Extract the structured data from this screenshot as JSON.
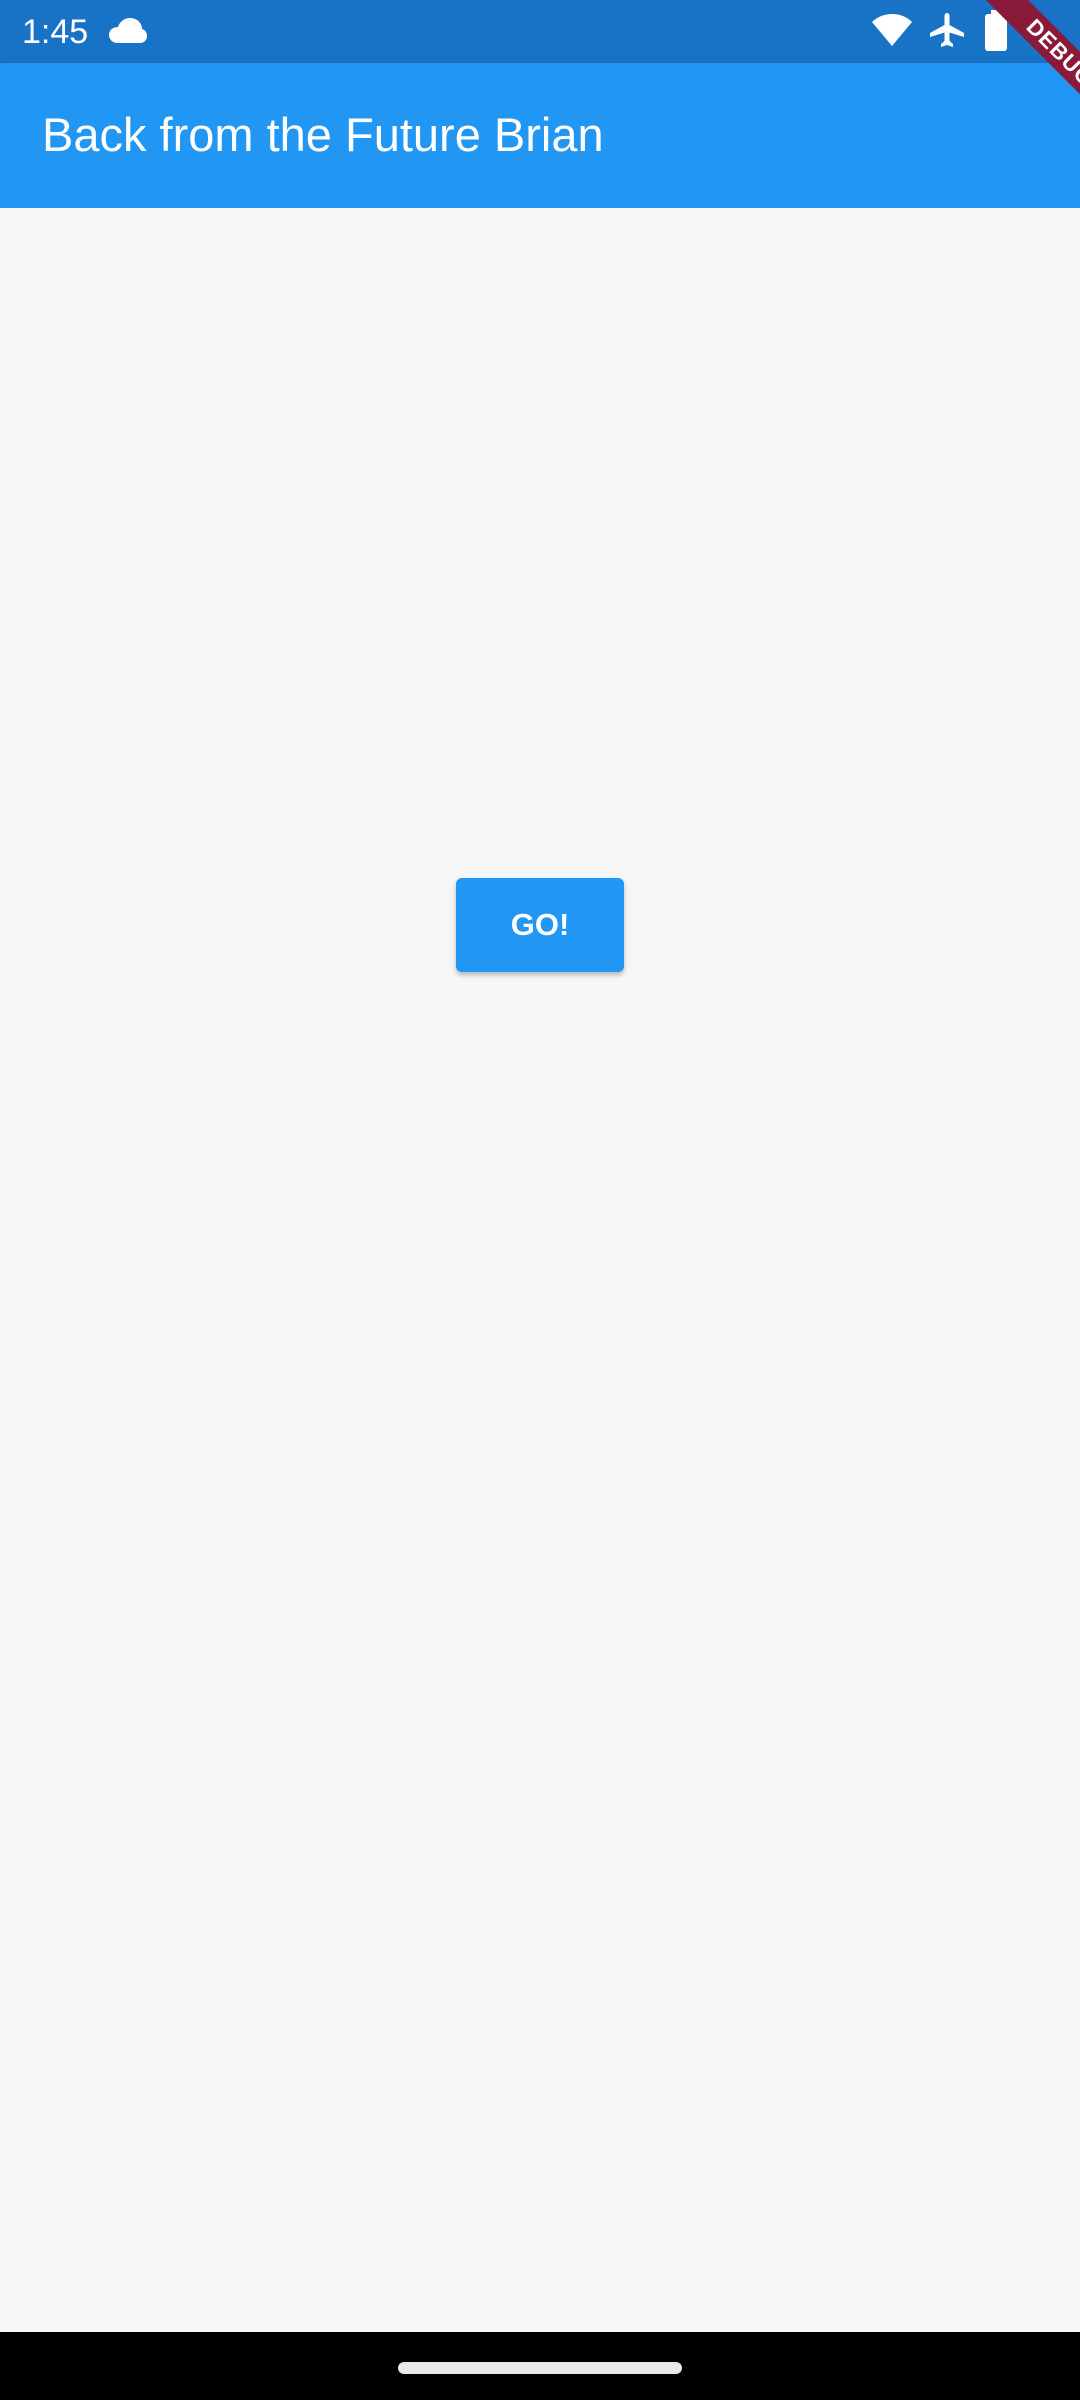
{
  "status_bar": {
    "time": "1:45",
    "icons": [
      "cloud-icon",
      "wifi-icon",
      "airplane-icon",
      "battery-icon"
    ]
  },
  "app_bar": {
    "title": "Back from the Future Brian",
    "color": "#2196f3"
  },
  "debug_banner": {
    "label": "DEBUG"
  },
  "main": {
    "go_button_label": "GO!"
  },
  "colors": {
    "status_bar": "#1873c7",
    "accent": "#2196f3",
    "background": "#f6f6f7",
    "debug_ribbon": "#8a1a3a"
  }
}
